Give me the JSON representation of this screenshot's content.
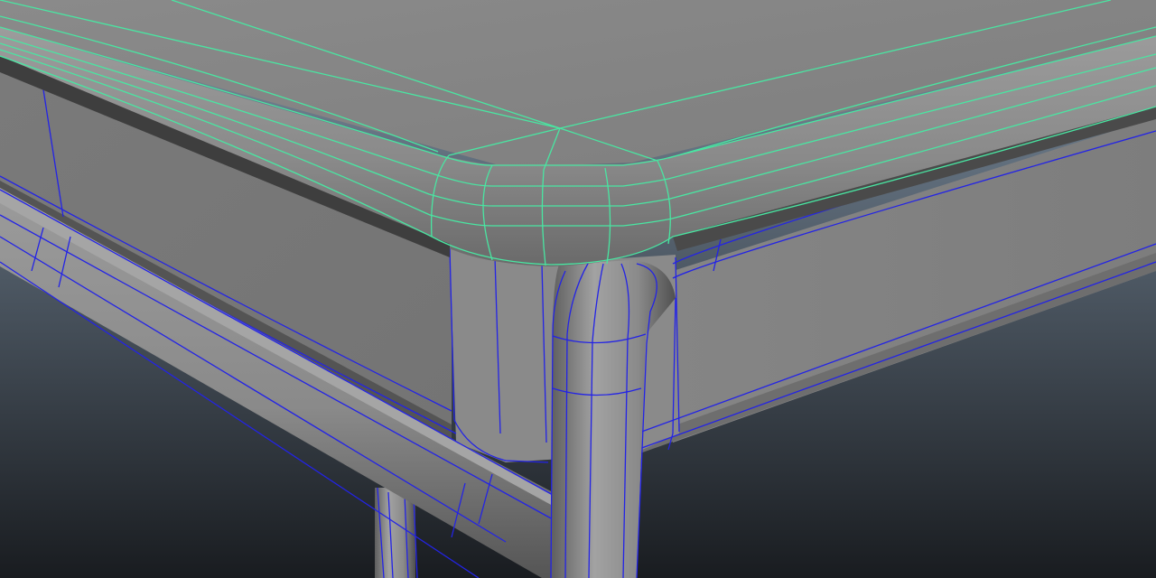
{
  "viewport": {
    "background_top": "#7d8fa1",
    "background_bottom": "#191c20"
  },
  "colors": {
    "surface_light": "#8f8f8f",
    "surface_mid": "#7c7c7c",
    "surface_dark": "#4b4b4b",
    "selected_wire": "#49e6a2",
    "unselected_wire": "#2323e6"
  },
  "objects": [
    {
      "name": "tabletop",
      "selected": true,
      "wire_color": "#49e6a2"
    },
    {
      "name": "apron",
      "selected": false,
      "wire_color": "#2323e6"
    },
    {
      "name": "leg-frame",
      "selected": false,
      "wire_color": "#2323e6"
    }
  ]
}
